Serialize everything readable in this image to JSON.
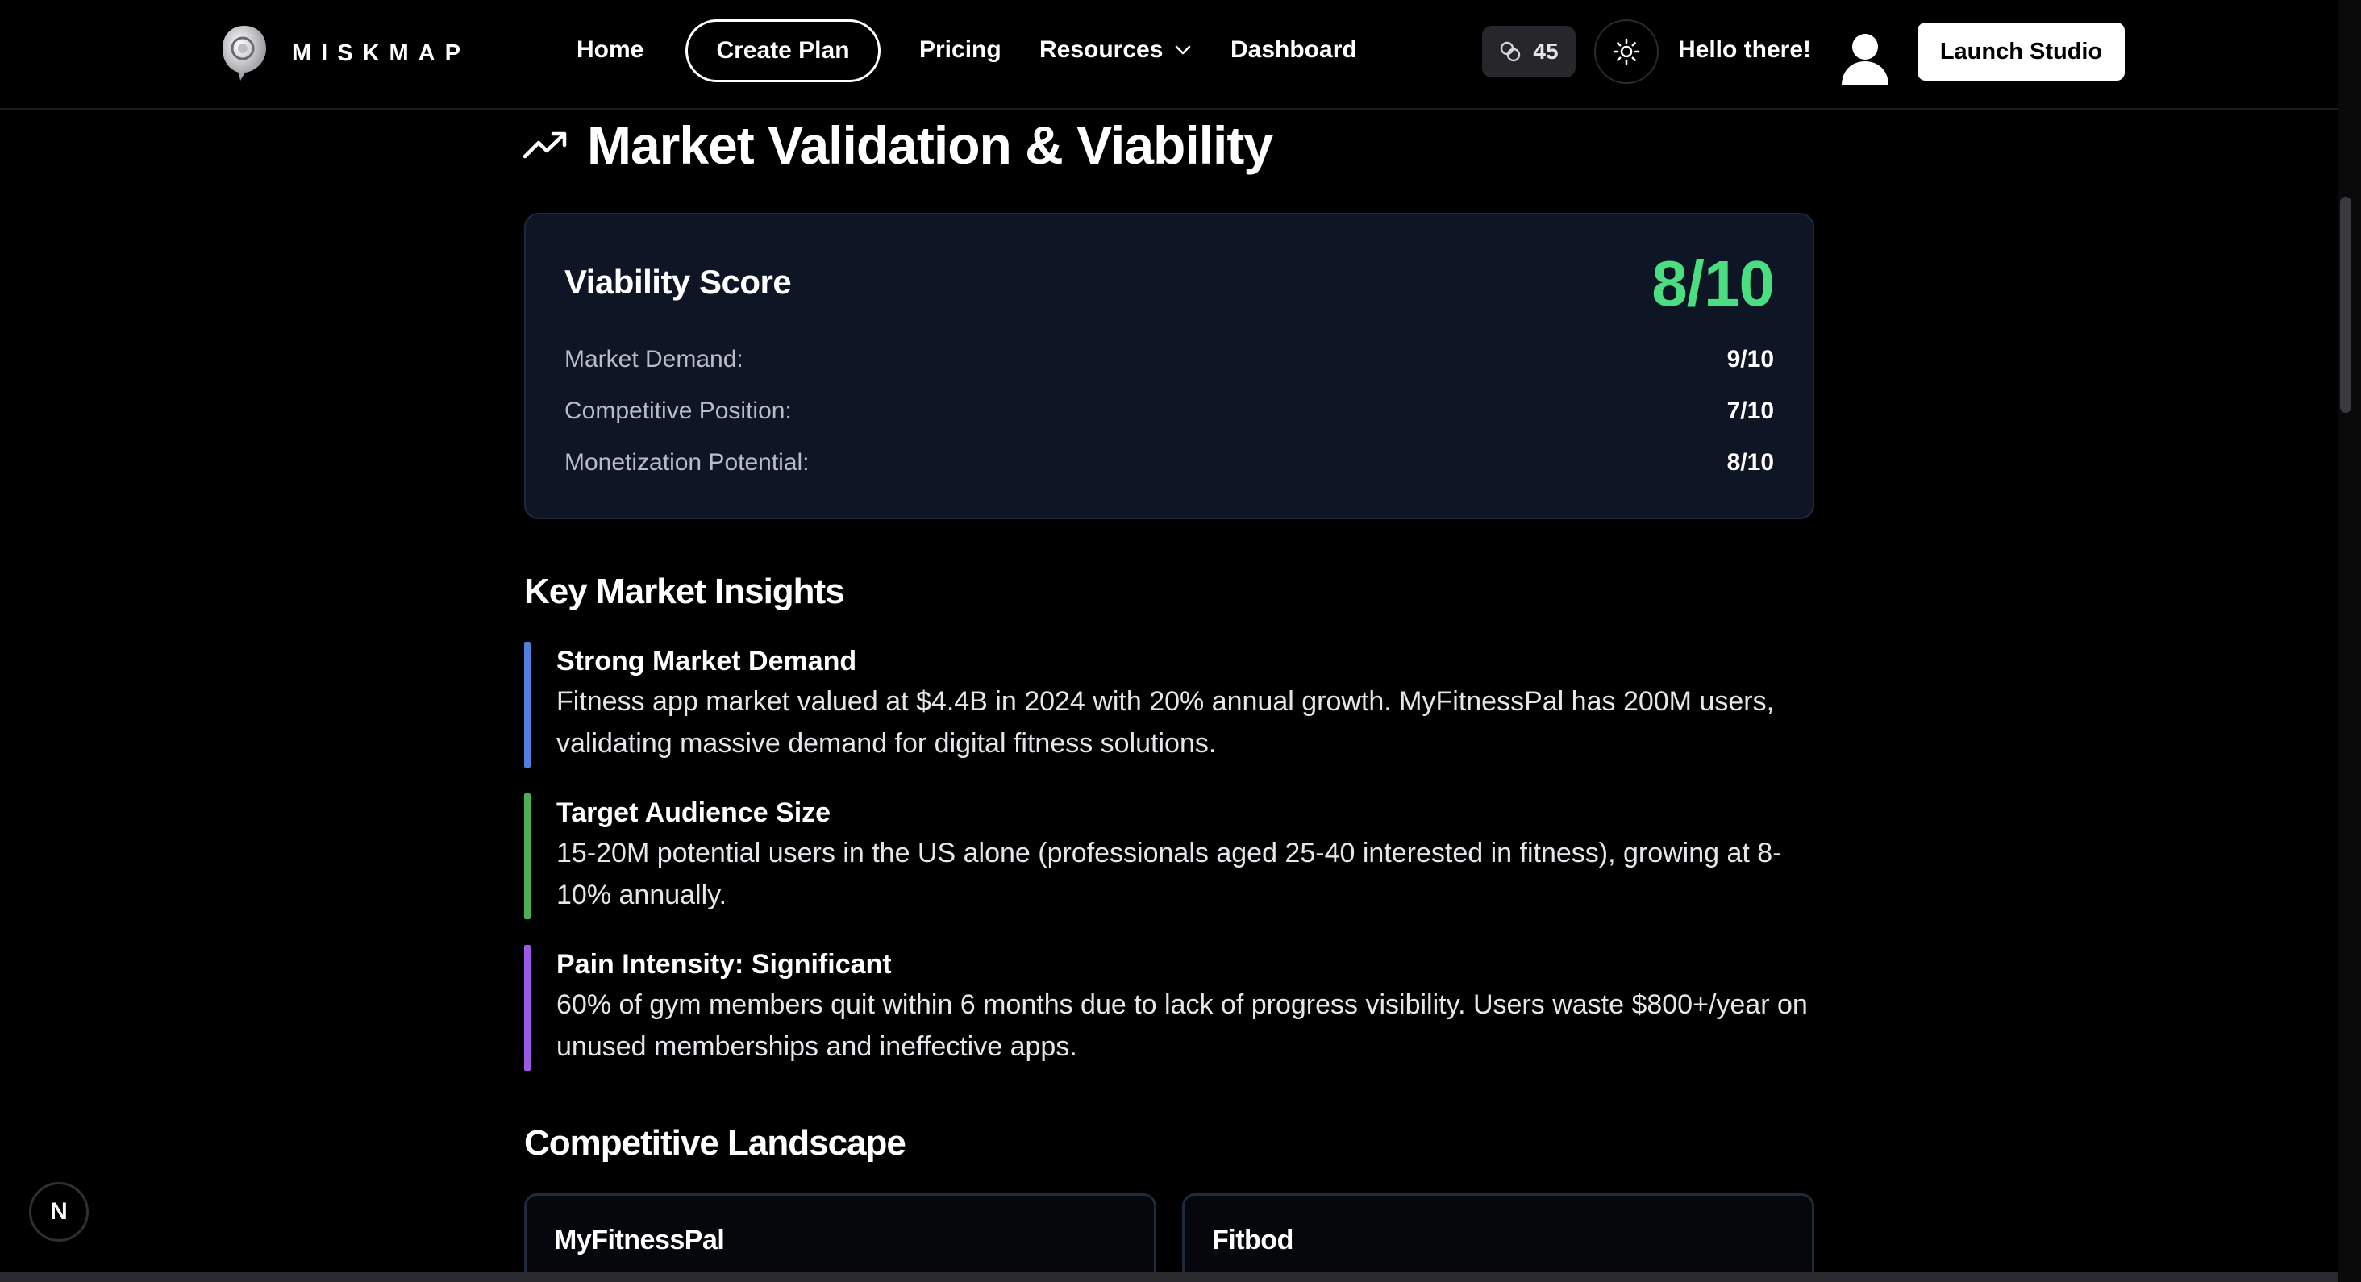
{
  "nav": {
    "brand": "MISKMAP",
    "links": {
      "home": "Home",
      "create_plan": "Create Plan",
      "pricing": "Pricing",
      "resources": "Resources",
      "dashboard": "Dashboard"
    },
    "credits": "45",
    "greeting": "Hello there!",
    "launch_button": "Launch Studio"
  },
  "page": {
    "section_title": "Market Validation & Viability",
    "viability": {
      "title": "Viability Score",
      "score": "8/10",
      "rows": [
        {
          "label": "Market Demand:",
          "value": "9/10"
        },
        {
          "label": "Competitive Position:",
          "value": "7/10"
        },
        {
          "label": "Monetization Potential:",
          "value": "8/10"
        }
      ]
    },
    "insights_title": "Key Market Insights",
    "insights": [
      {
        "title": "Strong Market Demand",
        "body": "Fitness app market valued at $4.4B in 2024 with 20% annual growth. MyFitnessPal has 200M users, validating massive demand for digital fitness solutions.",
        "accent": "#4f7fe0"
      },
      {
        "title": "Target Audience Size",
        "body": "15-20M potential users in the US alone (professionals aged 25-40 interested in fitness), growing at 8-10% annually.",
        "accent": "#4caf50"
      },
      {
        "title": "Pain Intensity: Significant",
        "body": "60% of gym members quit within 6 months due to lack of progress visibility. Users waste $800+/year on unused memberships and ineffective apps.",
        "accent": "#9b59e6"
      }
    ],
    "competitive_title": "Competitive Landscape",
    "competitors": [
      "MyFitnessPal",
      "Fitbod"
    ]
  },
  "dev_badge": "N",
  "colors": {
    "background": "#000000",
    "card": "#0e1626",
    "score_green": "#4ade80"
  }
}
